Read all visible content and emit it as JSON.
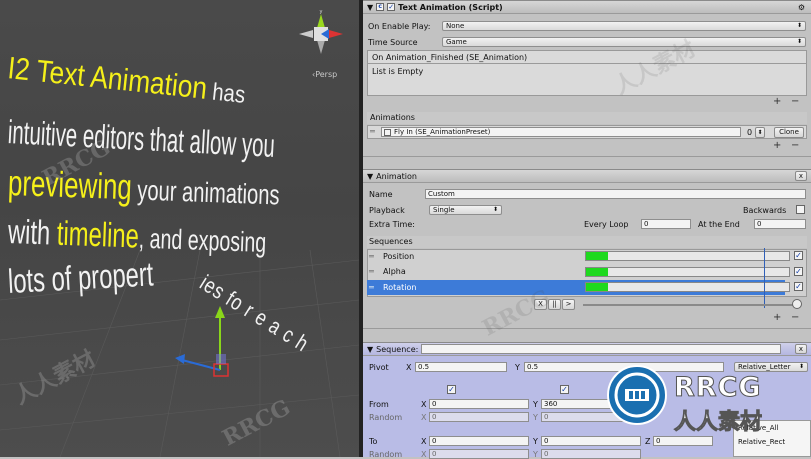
{
  "promo": {
    "l1a": "I2 Text Animation",
    "l1b": " has",
    "l2": "intuitive editors that allow you",
    "l3a": "previewing",
    "l3b": " your animations",
    "l4a": "with ",
    "l4b": "timeline",
    "l4c": ", and exposing",
    "l5": "lots of propert",
    "wave": "ies fo r e a c h"
  },
  "scene": {
    "persp_label": "‹Persp"
  },
  "script": {
    "title": "Text Animation (Script)",
    "on_enable_label": "On Enable Play:",
    "on_enable_value": "None",
    "time_source_label": "Time Source",
    "time_source_value": "Game",
    "event_header": "On Animation_Finished (SE_Animation)",
    "event_empty": "List is Empty",
    "animations_label": "Animations",
    "anim_item": "Fly In (SE_AnimationPreset)",
    "clone_label": "Clone",
    "anim_index": "0",
    "plus": "+",
    "minus": "−"
  },
  "animation": {
    "title": "Animation",
    "name_label": "Name",
    "name_value": "Custom",
    "playback_label": "Playback",
    "playback_value": "Single",
    "backwards_label": "Backwards",
    "extra_label": "Extra Time:",
    "every_loop_label": "Every Loop",
    "every_loop_value": "0",
    "at_end_label": "At the End",
    "at_end_value": "0",
    "sequences_label": "Sequences",
    "sequences": [
      {
        "name": "Position",
        "enabled": true,
        "fill": 0.11
      },
      {
        "name": "Alpha",
        "enabled": true,
        "fill": 0.11
      },
      {
        "name": "Rotation",
        "enabled": true,
        "fill": 0.11,
        "selected": true
      }
    ],
    "timeline_buttons": [
      "X",
      "||",
      ">"
    ],
    "timeline_pos": 0.98
  },
  "sequence": {
    "title": "Sequence:",
    "pivot_label": "Pivot",
    "pivot_x": "0.5",
    "pivot_y": "0.5",
    "relative_value": "Relative_Letter",
    "from_label": "From",
    "from_x": "0",
    "from_y": "360",
    "random_label": "Random",
    "random_x": "0",
    "random_y": "0",
    "to_label": "To",
    "to_x": "0",
    "to_y": "0",
    "to_z": "0",
    "random2_x": "0",
    "random2_y": "0",
    "axis_x": "X",
    "axis_y": "Y",
    "axis_z": "Z"
  },
  "context_menu": [
    "Relative_All",
    "Relative_Rect"
  ],
  "watermark": {
    "brand": "RRCG",
    "cn": "人人素材"
  },
  "colors": {
    "accent": "#3d7bd8",
    "progress": "#1ed91e",
    "promo_yellow": "#f5f01a",
    "sequence_bg": "#b9bce6"
  }
}
